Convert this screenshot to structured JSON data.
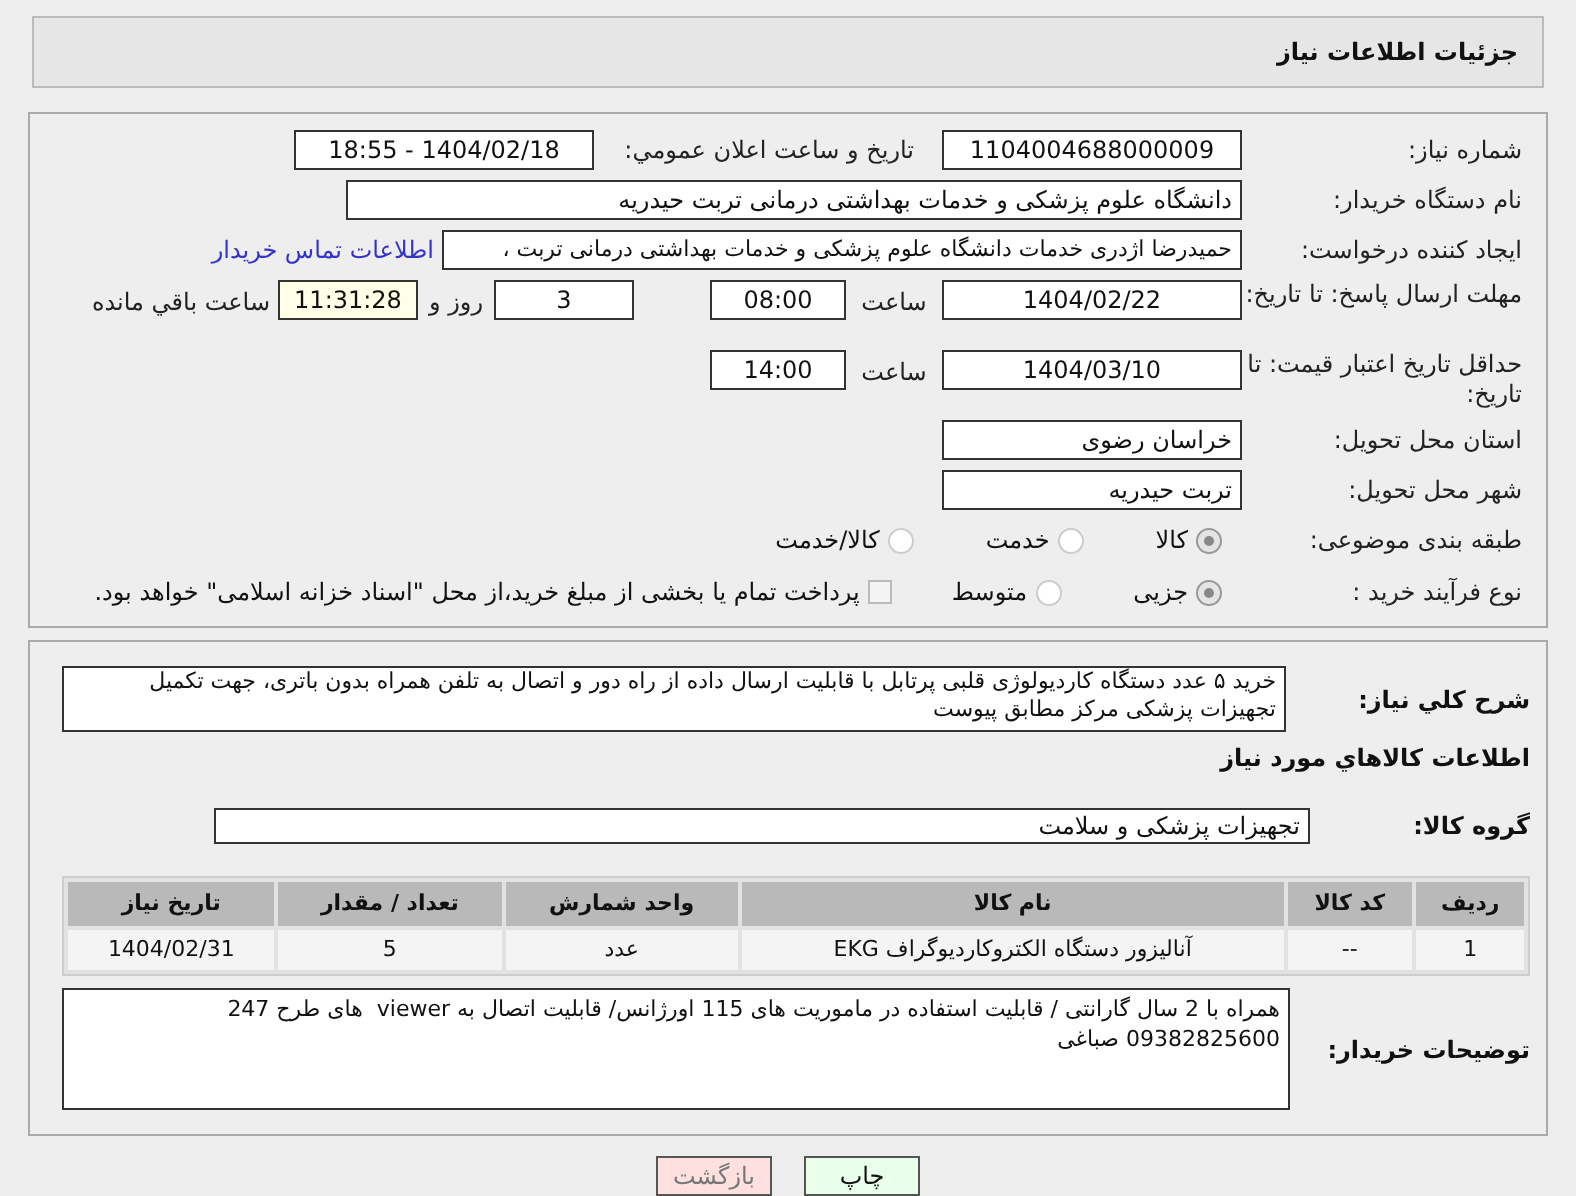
{
  "header": {
    "title": "جزئیات اطلاعات نیاز"
  },
  "need_number": {
    "label": "شماره نیاز:",
    "value": "1104004688000009"
  },
  "announce": {
    "label": "تاریخ و ساعت اعلان عمومي:",
    "value": "1404/02/18 - 18:55"
  },
  "buyer": {
    "label": "نام دستگاه خریدار:",
    "value": "دانشگاه علوم پزشکی و خدمات بهداشتی درمانی تربت حیدریه"
  },
  "requester": {
    "label": "ایجاد کننده درخواست:",
    "value": "حمیدرضا اژدری خدمات دانشگاه علوم پزشکی و خدمات بهداشتی درمانی تربت ،",
    "link": "اطلاعات تماس خریدار"
  },
  "deadline": {
    "label": "مهلت ارسال پاسخ: تا تاریخ:",
    "date": "1404/02/22",
    "time_label": "ساعت",
    "time": "08:00",
    "days": "3",
    "days_label": "روز و",
    "remaining": "11:31:28",
    "remaining_label": "ساعت باقي مانده"
  },
  "validity": {
    "label": "حداقل تاریخ اعتبار قیمت: تا تاریخ:",
    "date": "1404/03/10",
    "time_label": "ساعت",
    "time": "14:00"
  },
  "province": {
    "label": "استان محل تحویل:",
    "value": "خراسان رضوی"
  },
  "city": {
    "label": "شهر محل تحویل:",
    "value": "تربت حیدریه"
  },
  "category": {
    "label": "طبقه بندی موضوعی:",
    "options": [
      {
        "label": "کالا",
        "selected": true
      },
      {
        "label": "خدمت",
        "selected": false
      },
      {
        "label": "کالا/خدمت",
        "selected": false
      }
    ]
  },
  "process": {
    "label": "نوع فرآیند خرید :",
    "options": [
      {
        "label": "جزیی",
        "selected": true
      },
      {
        "label": "متوسط",
        "selected": false
      }
    ],
    "treasury": {
      "label": "پرداخت تمام یا بخشی از مبلغ خرید،از محل \"اسناد خزانه اسلامی\" خواهد بود.",
      "checked": false
    }
  },
  "summary": {
    "label": "شرح كلي نياز:",
    "value": "خرید ۵ عدد دستگاه کاردیولوژی قلبی پرتابل  با قابلیت ارسال داده از راه دور و اتصال به تلفن همراه بدون باتری، جهت تکمیل تجهیزات پزشکی مرکز مطابق پیوست"
  },
  "goods_title": "اطلاعات كالاهاي مورد نياز",
  "goods_group": {
    "label": "گروه کالا:",
    "value": "تجهیزات پزشکی و سلامت"
  },
  "table": {
    "columns": [
      "رديف",
      "کد کالا",
      "نام کالا",
      "واحد شمارش",
      "تعداد / مقدار",
      "تاریخ نیاز"
    ],
    "rows": [
      [
        "1",
        "--",
        "آنالیزور دستگاه الکتروکاردیوگراف EKG",
        "عدد",
        "5",
        "1404/02/31"
      ]
    ]
  },
  "notes": {
    "label": "توضیحات خریدار:",
    "value": "همراه با 2 سال گارانتی / قابلیت استفاده در ماموریت های 115 اورژانس/ قابلیت اتصال به viewer  های طرح 247\n09382825600 صباغی"
  },
  "buttons": [
    {
      "label": "چاپ",
      "kind": "print"
    },
    {
      "label": "بازگشت",
      "kind": "back"
    }
  ]
}
